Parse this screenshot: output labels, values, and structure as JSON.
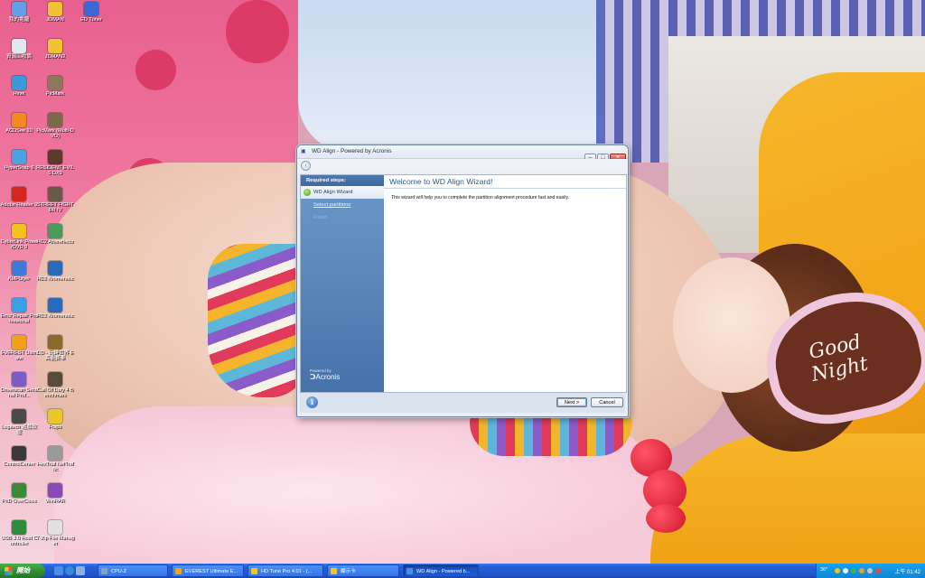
{
  "desktop_icons": [
    {
      "label": "我的電腦",
      "color": "#5fa0e8"
    },
    {
      "label": "資源回收筒",
      "color": "#dfe8f0"
    },
    {
      "label": "Hinet",
      "color": "#3a9ad9"
    },
    {
      "label": "ACDSee 10",
      "color": "#f08a22"
    },
    {
      "label": "HyperSnap 6",
      "color": "#4aa3df"
    },
    {
      "label": "Adobe Reader 9",
      "color": "#d8261d"
    },
    {
      "label": "CyberLink PowerDVD 9",
      "color": "#f2c21c"
    },
    {
      "label": "KMPlayer",
      "color": "#3c7cd8"
    },
    {
      "label": "Error Repair Professional",
      "color": "#3aa0e6"
    },
    {
      "label": "EVEREST Ultimate",
      "color": "#f0a11c"
    },
    {
      "label": "Driverscan Sentinel Prof...",
      "color": "#7a5cc8"
    },
    {
      "label": "Logitech 遊戲軟體",
      "color": "#4a4a4a"
    },
    {
      "label": "ControlCenter",
      "color": "#3a3a3a"
    },
    {
      "label": "PhD OverClock",
      "color": "#3a8a3a"
    },
    {
      "label": "USB 3.0 Host Controller",
      "color": "#2e8b3a"
    },
    {
      "label": "JDMAN",
      "color": "#f1c232"
    },
    {
      "label": "JDMAN2",
      "color": "#f1c232"
    },
    {
      "label": "PicMark",
      "color": "#8a7a5a"
    },
    {
      "label": "PicMark (Multi-DVD)",
      "color": "#7a6a4a"
    },
    {
      "label": "RESIDENT EVIL 5 DX9",
      "color": "#5a3a2a"
    },
    {
      "label": "STREET FIGHTER IV",
      "color": "#6a5a4a"
    },
    {
      "label": "HD2 Aftereffects",
      "color": "#4a9a5a"
    },
    {
      "label": "HD2 Kromenotic",
      "color": "#2a6aba"
    },
    {
      "label": "HD2 Kromenotic",
      "color": "#2a6aba"
    },
    {
      "label": "DD - 玩轉世界 E 高能賽車",
      "color": "#8a6a2a"
    },
    {
      "label": "Call Of Duty 4 Benchmark",
      "color": "#5a4a3a"
    },
    {
      "label": "Fraps",
      "color": "#e8c82a"
    },
    {
      "label": "HexTrial NetTraffic",
      "color": "#9a9a9a"
    },
    {
      "label": "WinRAR",
      "color": "#8a4ab8"
    },
    {
      "label": "7-Zip File Manager",
      "color": "#e0e0e0"
    },
    {
      "label": "ED Tuner",
      "color": "#3a6ad8"
    }
  ],
  "window": {
    "title": "WD Align - Powered by Acronis",
    "steps_header": "Required steps:",
    "steps": [
      {
        "label": "WD Align Wizard"
      },
      {
        "label": "Select partitions"
      },
      {
        "label": "Finish"
      }
    ],
    "brand_sub": "Powered by",
    "brand_name": "Acronis",
    "heading": "Welcome to WD Align Wizard!",
    "description": "This wizard will help you to complete the partition alignment procedure fast and easily.",
    "next_label": "Next >",
    "cancel_label": "Cancel"
  },
  "taskbar": {
    "start_label": "開始",
    "tasks": [
      {
        "label": "CPU-Z",
        "color": "#8aa0c0"
      },
      {
        "label": "EVEREST Ultimate E...",
        "color": "#f0a11c"
      },
      {
        "label": "HD Tune Pro 4.01 - (...",
        "color": "#e8c82a"
      },
      {
        "label": "顯示卡",
        "color": "#f1c232"
      },
      {
        "label": "WD Align - Powered b...",
        "color": "#4a90e2"
      }
    ],
    "tray_temp": "36°",
    "clock": "上午 01:42"
  }
}
